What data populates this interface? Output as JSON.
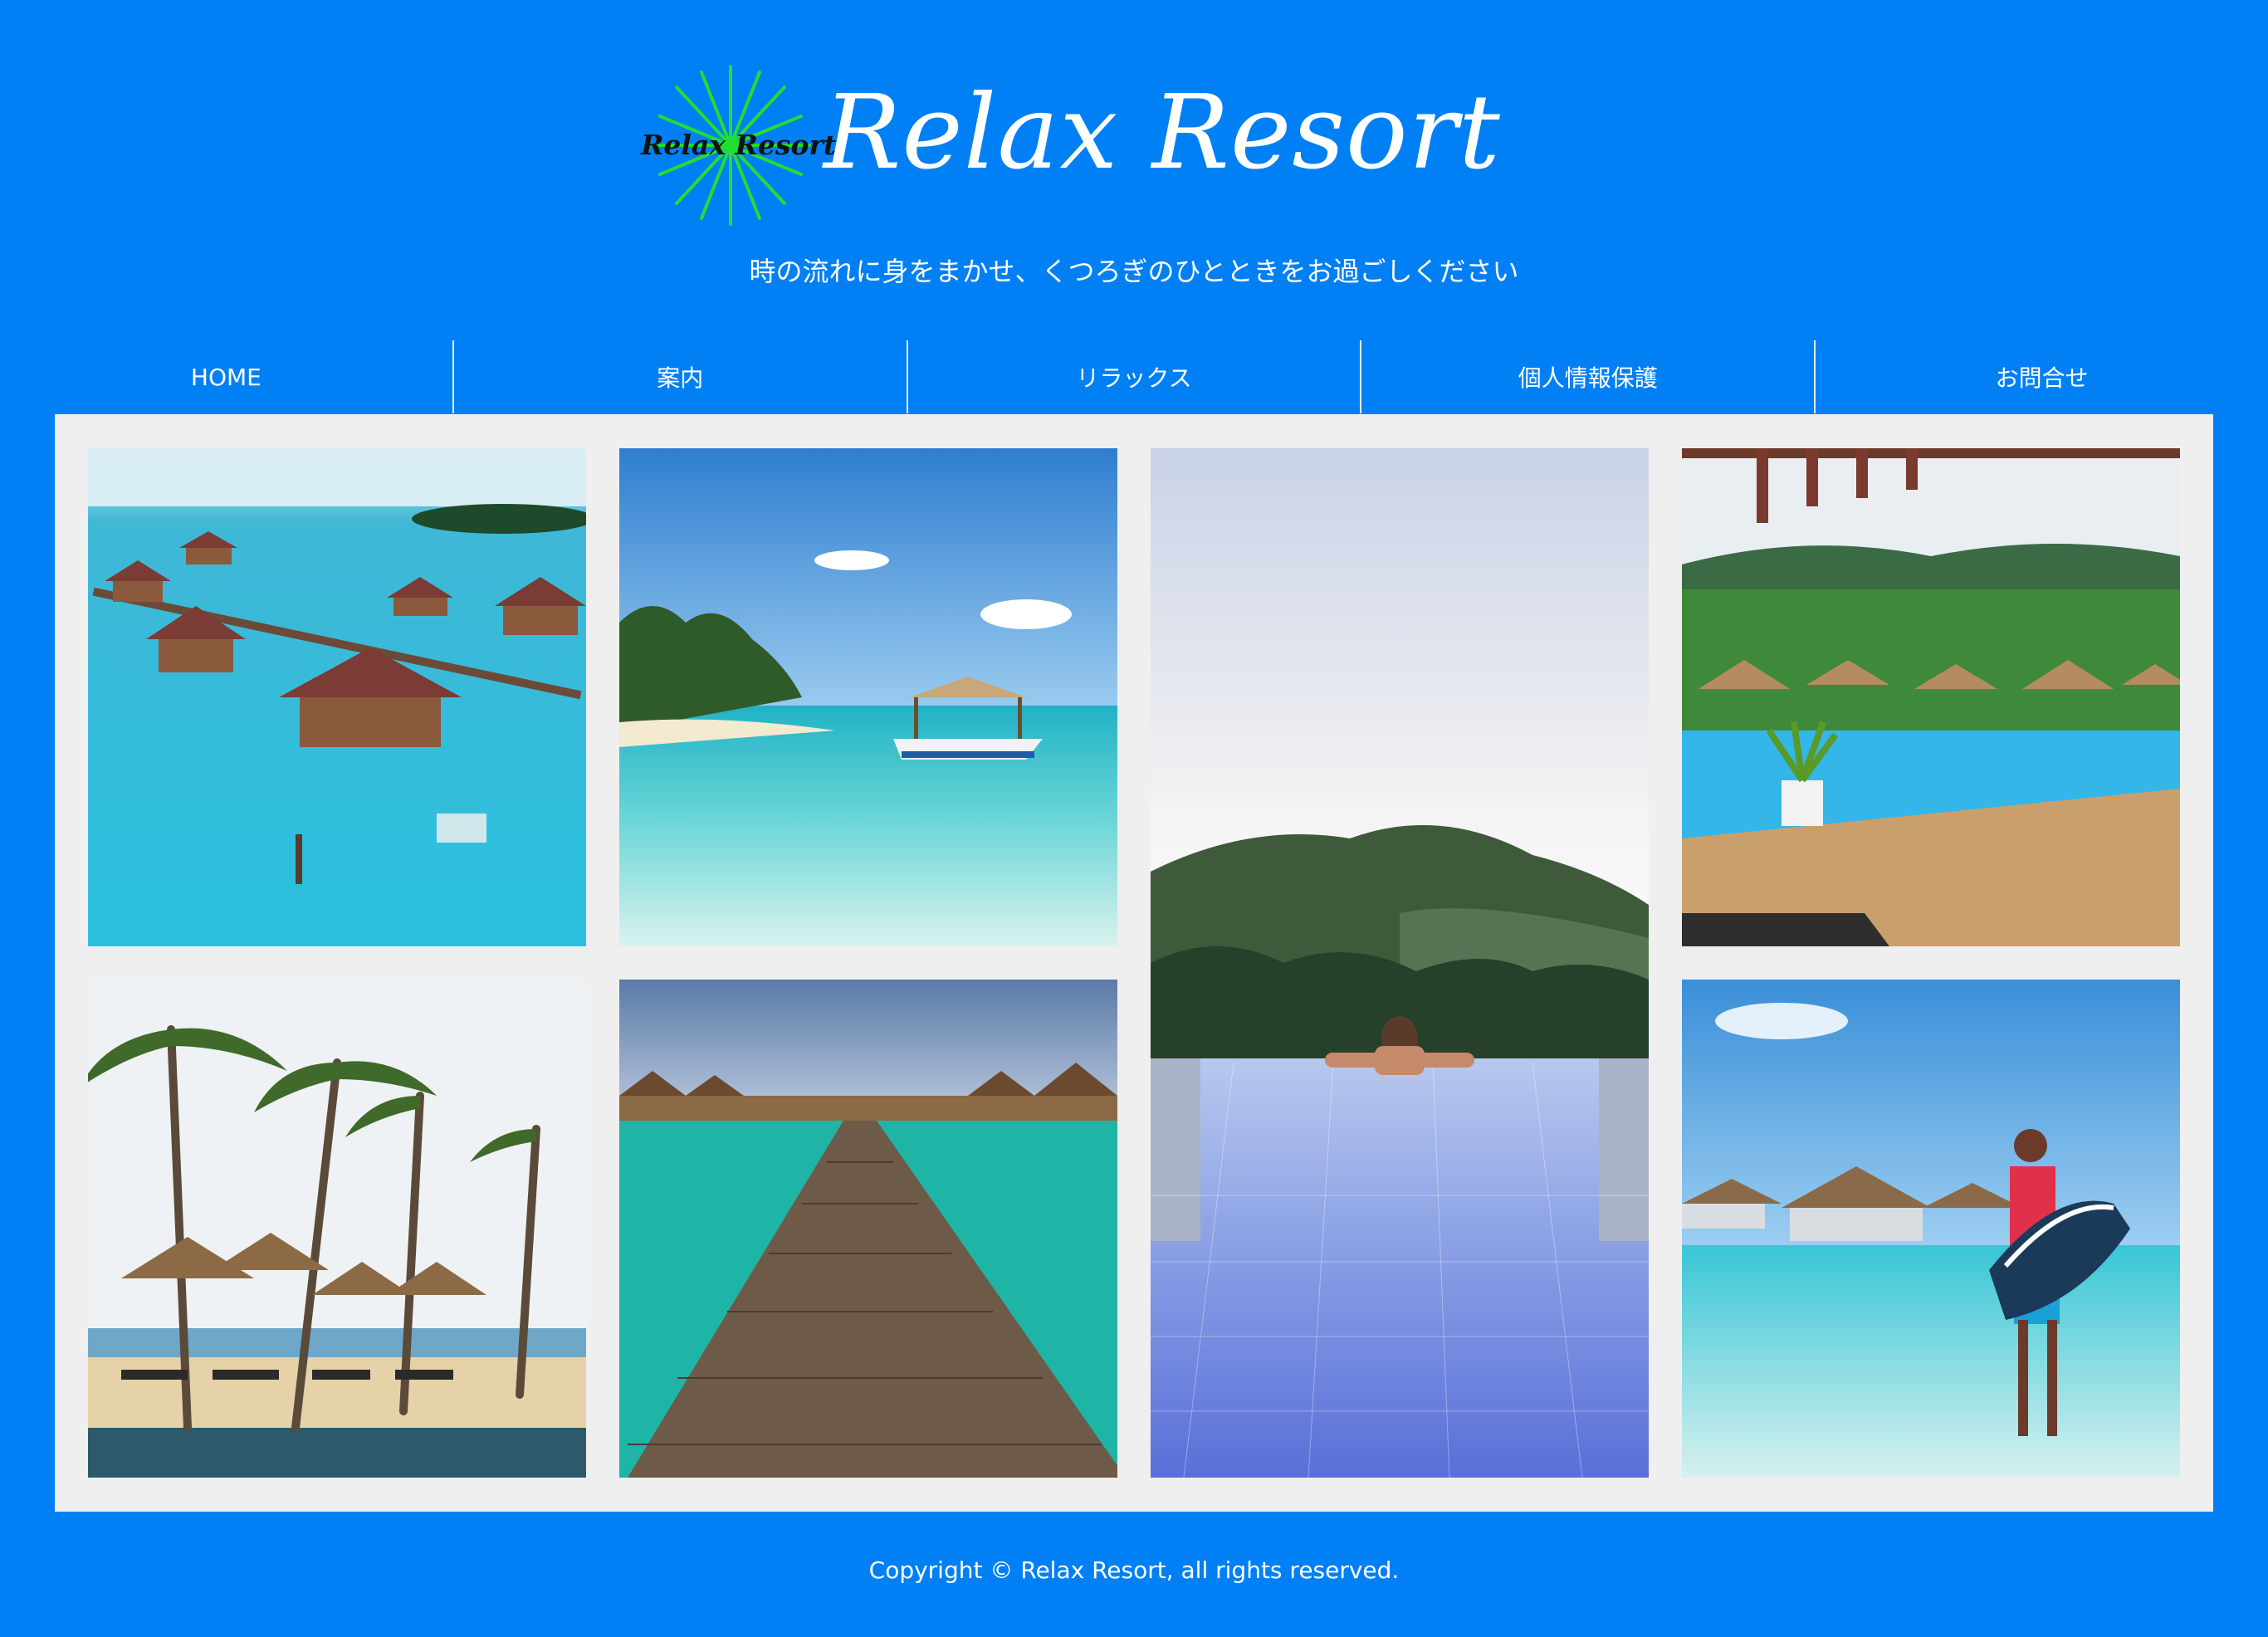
{
  "header": {
    "logo_text": "Relax Resort",
    "brand_title": "Relax Resort",
    "tagline": "時の流れに身をまかせ、くつろぎのひとときをお過ごしください"
  },
  "nav": {
    "items": [
      {
        "label": "HOME"
      },
      {
        "label": "案内"
      },
      {
        "label": "リラックス"
      },
      {
        "label": "個人情報保護"
      },
      {
        "label": "お問合せ"
      }
    ]
  },
  "footer": {
    "copyright": "Copyright © Relax Resort, all rights reserved."
  },
  "colors": {
    "background": "#0080f4",
    "gallery_bg": "#efefef",
    "text": "#ffffff",
    "logo_rays": "#22dd33"
  }
}
